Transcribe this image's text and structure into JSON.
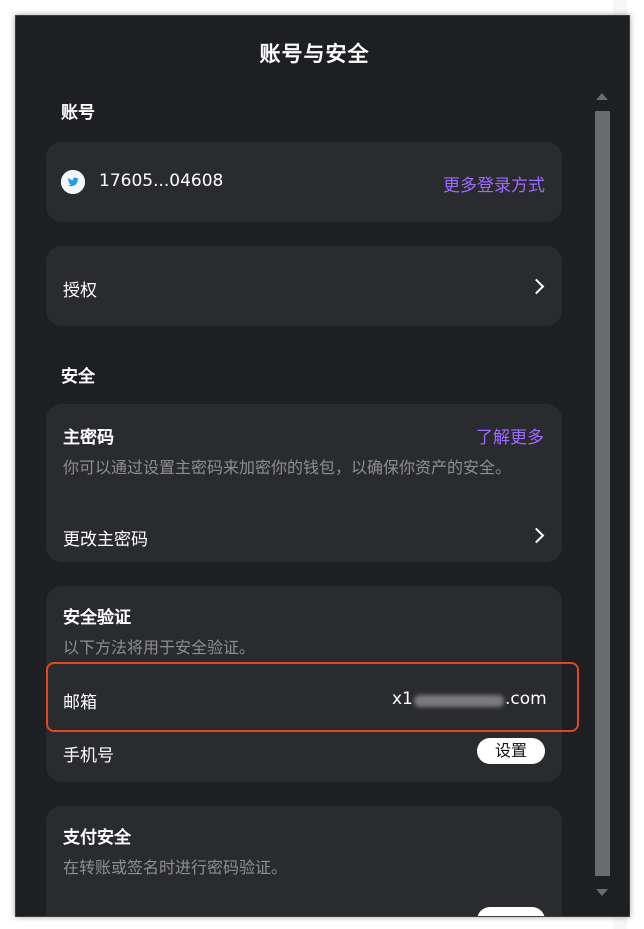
{
  "header": {
    "title": "账号与安全"
  },
  "account": {
    "section_label": "账号",
    "user_id": "17605...04608",
    "more_login_label": "更多登录方式",
    "avatar_icon": "twitter-bird-icon",
    "authorization_label": "授权"
  },
  "security": {
    "section_label": "安全",
    "master_password": {
      "title": "主密码",
      "learn_more_label": "了解更多",
      "description": "你可以通过设置主密码来加密你的钱包，以确保你资产的安全。",
      "change_label": "更改主密码"
    },
    "verification": {
      "title": "安全验证",
      "description": "以下方法将用于安全验证。",
      "email_label": "邮箱",
      "email_prefix": "x1",
      "email_suffix": ".com",
      "phone_label": "手机号",
      "phone_button_label": "设置"
    },
    "payment": {
      "title": "支付安全",
      "description": "在转账或签名时进行密码验证。"
    }
  },
  "colors": {
    "background": "#1e1f22",
    "card": "#2a2b2f",
    "accent": "#9d6bff",
    "highlight": "#e3471d"
  }
}
